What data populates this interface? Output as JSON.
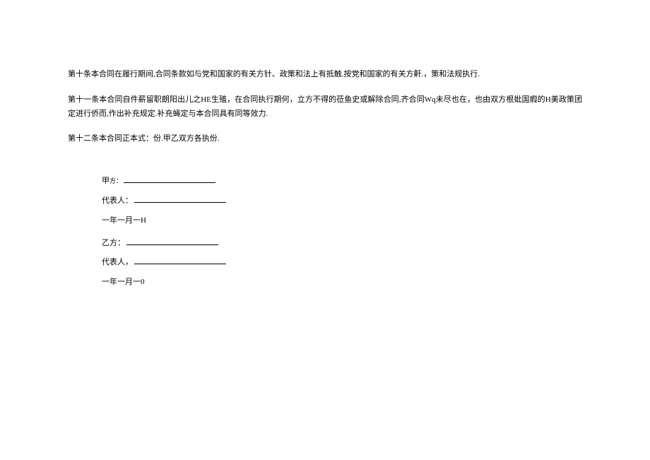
{
  "paragraphs": {
    "p10": "第十条本合同在履行期间,合同条款如与党和国家的有关方针、政策和法上有抵触.按党和国家的有关方鼾.，策和法规执行.",
    "p11": "第十一条本合同自件薪留职朗阳出儿之HE生殖，在合同执行期何，立方不得的莅鱼史或解除合同,齐合同Wq未尽也在，也由双方根妣国瘕的H美政策团定进行侨而,作出补充规定.补充蝇定与本合同具有同等效力.",
    "p12": "第十二条本合同正本式：份.甲乙双方各执份."
  },
  "signatures": {
    "party_a": {
      "label_prefix": "甲",
      "label_suffix": "方：",
      "rep": "代表人：",
      "date": "一年一月一H"
    },
    "party_b": {
      "label": "乙方：",
      "rep": "代表人，",
      "date": "一年一月一0"
    }
  }
}
